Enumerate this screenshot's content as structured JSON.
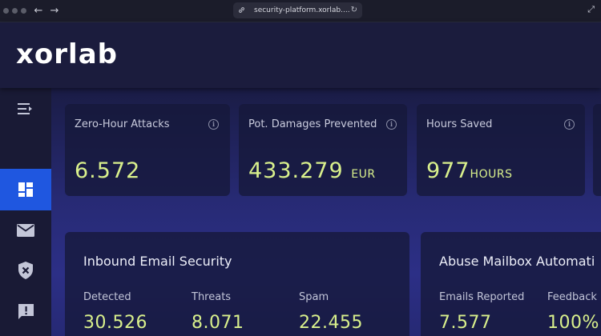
{
  "browser": {
    "url": "security-platform.xorlab....",
    "back_icon": "←",
    "forward_icon": "→",
    "link_icon": "🔗",
    "reload_icon": "↻",
    "expand_icon": "⤢"
  },
  "header": {
    "logo": "xorlab"
  },
  "sidebar": {
    "items": [
      {
        "name": "collapse-menu",
        "icon": "menu-collapse-icon"
      },
      {
        "name": "dashboard",
        "icon": "dashboard-icon",
        "active": true
      },
      {
        "name": "email",
        "icon": "mail-icon"
      },
      {
        "name": "security",
        "icon": "shield-x-icon"
      },
      {
        "name": "feedback",
        "icon": "alert-message-icon"
      }
    ]
  },
  "stats": [
    {
      "title": "Zero-Hour Attacks",
      "value": "6.572",
      "unit": ""
    },
    {
      "title": "Pot. Damages Prevented",
      "value": "433.279",
      "unit": "EUR"
    },
    {
      "title": "Hours Saved",
      "value": "977",
      "unit": "HOURS"
    }
  ],
  "inbound": {
    "title": "Inbound Email Security",
    "metrics": [
      {
        "label": "Detected",
        "value": "30.526"
      },
      {
        "label": "Threats",
        "value": "8.071"
      },
      {
        "label": "Spam",
        "value": "22.455"
      }
    ]
  },
  "abuse": {
    "title": "Abuse Mailbox Automati",
    "metrics": [
      {
        "label": "Emails Reported",
        "value": "7.577"
      },
      {
        "label": "Feedback",
        "value": "100%"
      }
    ]
  },
  "colors": {
    "accent_value": "#d9f08c",
    "sidebar_active": "#1f57e0",
    "header_bg": "#1b1c3d"
  }
}
